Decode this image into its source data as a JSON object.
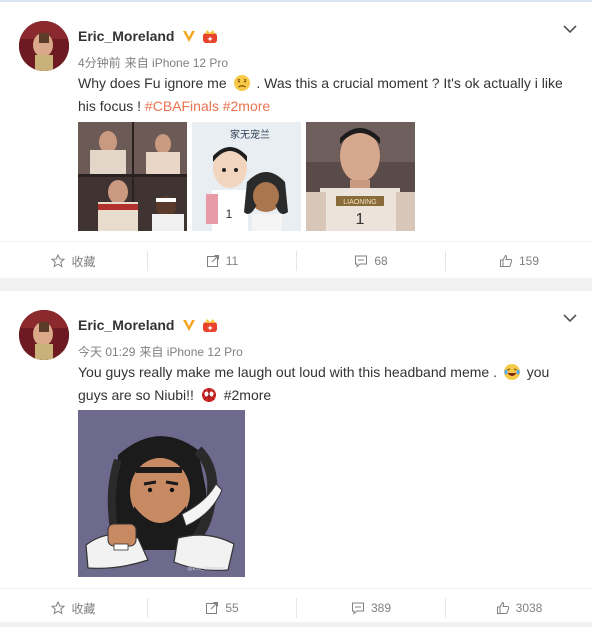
{
  "posts": [
    {
      "author": "Eric_Moreland",
      "time": "4分钟前",
      "source": "来自 iPhone 12 Pro",
      "text_a": "Why does Fu ignore me",
      "text_b": ". Was this a crucial moment ? It's ok actually i like his focus !",
      "hashtag1": "#CBAFinals",
      "hashtag2": "#2more",
      "image_caption": "家无宠兰",
      "actions": {
        "favorite_label": "收藏",
        "reposts": "11",
        "comments": "68",
        "likes": "159"
      }
    },
    {
      "author": "Eric_Moreland",
      "time": "今天 01:29",
      "source": "来自 iPhone 12 Pro",
      "text_a": "You guys really make me laugh out loud with this headband meme .",
      "text_b": "you guys are so Niubi!!",
      "hashtag1": "#2more",
      "image_watermark": "@Eric_Moreland",
      "actions": {
        "favorite_label": "收藏",
        "reposts": "55",
        "comments": "389",
        "likes": "3038"
      }
    }
  ],
  "colors": {
    "hashtag": "#eb7350",
    "verified": "#f5a623",
    "muted": "#808080"
  },
  "icons": [
    "verified-v-icon",
    "crown-badge-icon",
    "chevron-down-icon",
    "star-icon",
    "repost-icon",
    "comment-icon",
    "thumbs-up-icon",
    "sad-face-emoji-icon",
    "laughing-face-emoji-icon",
    "spider-emoji-icon"
  ]
}
